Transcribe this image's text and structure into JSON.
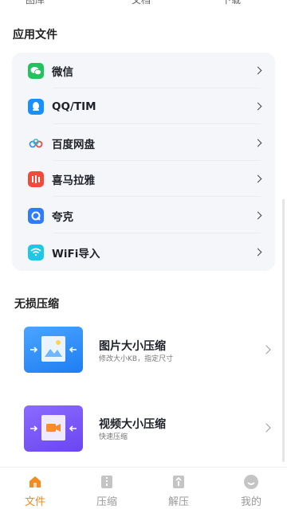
{
  "top_cutoff": [
    "图库",
    "文档",
    "下载"
  ],
  "apps_section": {
    "title": "应用文件",
    "items": [
      {
        "label": "微信",
        "icon": "wechat-icon",
        "color": "#22c35e"
      },
      {
        "label": "QQ/TIM",
        "icon": "qq-icon",
        "color": "#1890ff"
      },
      {
        "label": "百度网盘",
        "icon": "baidu-netdisk-icon",
        "color": "#3a8ef6"
      },
      {
        "label": "喜马拉雅",
        "icon": "ximalaya-icon",
        "color": "#f24a3a"
      },
      {
        "label": "夸克",
        "icon": "quark-icon",
        "color": "#2f7cf6"
      },
      {
        "label": "WiFi导入",
        "icon": "wifi-icon",
        "color": "#1cc8e6"
      }
    ]
  },
  "tools_section": {
    "title": "无损压缩",
    "items": [
      {
        "title": "图片大小压缩",
        "subtitle": "修改大小KB，指定尺寸",
        "icon": "image-compress-icon",
        "color": "#2f8ef8"
      },
      {
        "title": "视频大小压缩",
        "subtitle": "快速压缩",
        "icon": "video-compress-icon",
        "color": "#7b5cf5"
      }
    ]
  },
  "tabs": [
    {
      "label": "文件",
      "icon": "home-icon",
      "active": true
    },
    {
      "label": "压缩",
      "icon": "zip-icon",
      "active": false
    },
    {
      "label": "解压",
      "icon": "unzip-icon",
      "active": false
    },
    {
      "label": "我的",
      "icon": "profile-icon",
      "active": false
    }
  ],
  "colors": {
    "accent": "#f58a1f",
    "card_bg": "#f5f6fa"
  }
}
